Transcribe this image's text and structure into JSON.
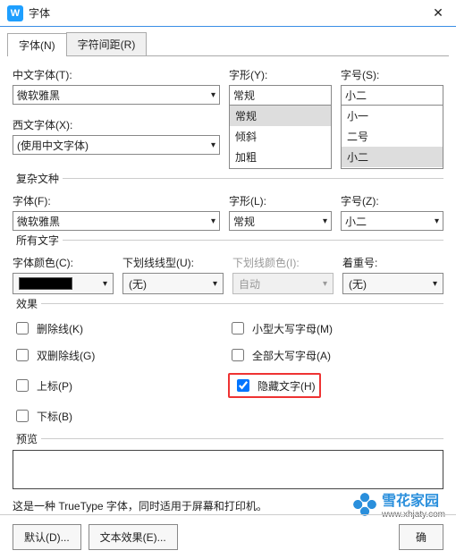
{
  "window": {
    "title": "字体"
  },
  "tabs": {
    "font": "字体(N)",
    "spacing": "字符间距(R)"
  },
  "labels": {
    "cn_font": "中文字体(T):",
    "en_font": "西文字体(X):",
    "style1": "字形(Y):",
    "size1": "字号(S):",
    "complex": "复杂文种",
    "font2": "字体(F):",
    "style2": "字形(L):",
    "size2": "字号(Z):",
    "allchars": "所有文字",
    "fontcolor": "字体颜色(C):",
    "underline": "下划线线型(U):",
    "underline_color": "下划线颜色(I):",
    "emphasis": "着重号:",
    "effects": "效果",
    "preview": "预览"
  },
  "values": {
    "cn_font": "微软雅黑",
    "en_font": "(使用中文字体)",
    "style1": "常规",
    "size1": "小二",
    "font2": "微软雅黑",
    "style2": "常规",
    "size2": "小二",
    "underline": "(无)",
    "underline_color": "自动",
    "emphasis": "(无)"
  },
  "lists": {
    "styles": [
      "常规",
      "倾斜",
      "加粗"
    ],
    "sizes": [
      "小一",
      "二号",
      "小二"
    ]
  },
  "checks": {
    "strike": "删除线(K)",
    "dstrike": "双删除线(G)",
    "sup": "上标(P)",
    "sub": "下标(B)",
    "smallcaps": "小型大写字母(M)",
    "allcaps": "全部大写字母(A)",
    "hidden": "隐藏文字(H)"
  },
  "note": "这是一种 TrueType 字体，同时适用于屏幕和打印机。",
  "buttons": {
    "default": "默认(D)...",
    "texteffect": "文本效果(E)...",
    "ok": "确"
  },
  "watermark": {
    "name": "雪花家园",
    "url": "www.xhjaty.com"
  }
}
